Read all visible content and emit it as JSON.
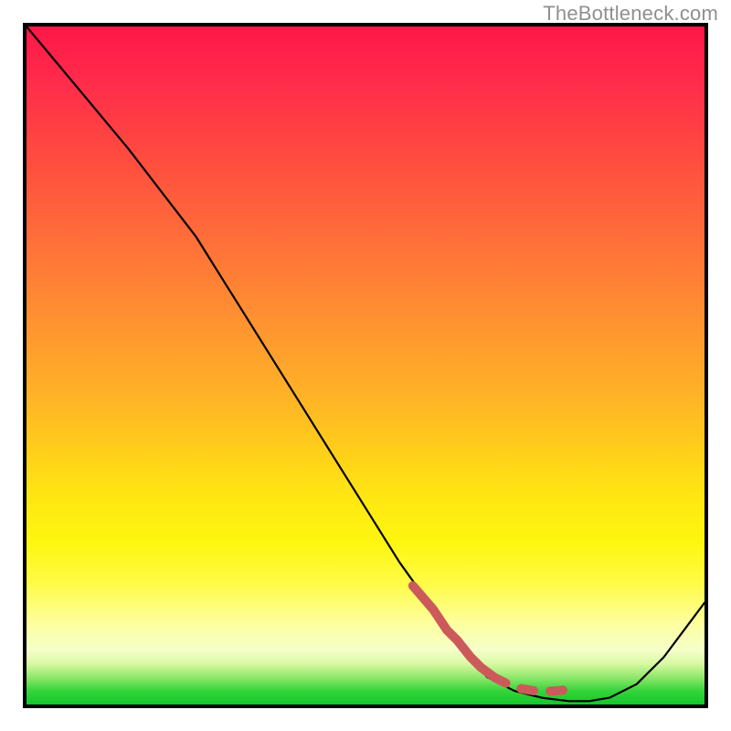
{
  "attribution": "TheBottleneck.com",
  "chart_data": {
    "type": "line",
    "title": "",
    "xlabel": "",
    "ylabel": "",
    "xlim": [
      0,
      100
    ],
    "ylim": [
      0,
      100
    ],
    "series": [
      {
        "name": "bottleneck-curve",
        "x": [
          0,
          5,
          10,
          15,
          20,
          25,
          30,
          35,
          40,
          45,
          50,
          55,
          60,
          62,
          65,
          68,
          72,
          76,
          80,
          83,
          86,
          90,
          94,
          100
        ],
        "values": [
          100,
          94,
          88,
          82,
          75.5,
          69,
          61,
          53,
          45,
          37,
          29,
          21,
          14,
          11,
          7,
          4,
          2,
          1,
          0.5,
          0.5,
          1,
          3,
          7,
          15
        ]
      },
      {
        "name": "highlight-segment",
        "x": [
          57,
          60,
          62,
          63.5,
          65.5,
          67,
          69,
          72,
          75,
          78,
          80
        ],
        "values": [
          17.5,
          14,
          11,
          9.5,
          7,
          5.5,
          4,
          2.5,
          2,
          2,
          2.2
        ]
      }
    ],
    "colors": {
      "curve": "#000000",
      "highlight": "#cc5a5a",
      "gradient_top": "#ff1748",
      "gradient_mid": "#ffd01a",
      "gradient_bottom": "#13c72c"
    }
  }
}
